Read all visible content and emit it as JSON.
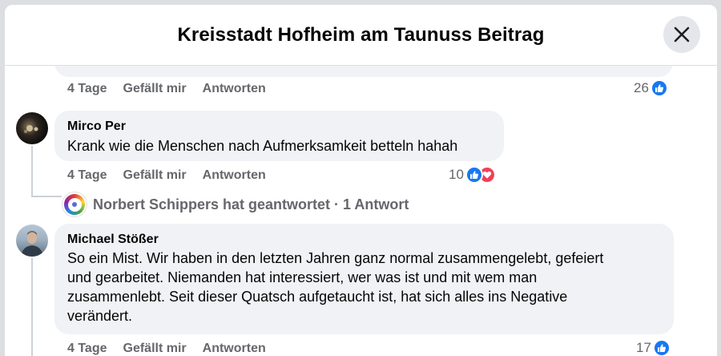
{
  "post": {
    "title": "Kreisstadt Hofheim am Taunuss Beitrag"
  },
  "prev_comment": {
    "time": "4 Tage",
    "like_label": "Gefällt mir",
    "reply_label": "Antworten",
    "reaction_count": "26"
  },
  "comments": [
    {
      "author": "Mirco Per",
      "text": "Krank wie die Menschen nach Aufmerksamkeit betteln hahah",
      "time": "4 Tage",
      "like_label": "Gefällt mir",
      "reply_label": "Antworten",
      "reaction_count": "10",
      "reply_summary": "Norbert Schippers hat geantwortet · 1 Antwort"
    },
    {
      "author": "Michael Stößer",
      "text_lines": [
        "So ein Mist. Wir haben in den letzten Jahren ganz normal zusammengelebt, gefeiert",
        "und gearbeitet. Niemanden hat interessiert, wer was ist und mit wem man",
        "zusammenlebt. Seit dieser Quatsch aufgetaucht ist, hat sich alles ins Negative",
        "verändert."
      ],
      "time": "4 Tage",
      "like_label": "Gefällt mir",
      "reply_label": "Antworten",
      "reaction_count": "17"
    }
  ],
  "icons": {
    "close": "close-icon",
    "like": "like-icon",
    "love": "love-icon"
  },
  "colors": {
    "like_blue": "#1877f2",
    "love_red": "#f33e58",
    "meta_gray": "#65676b",
    "bubble_bg": "#f0f2f5"
  }
}
